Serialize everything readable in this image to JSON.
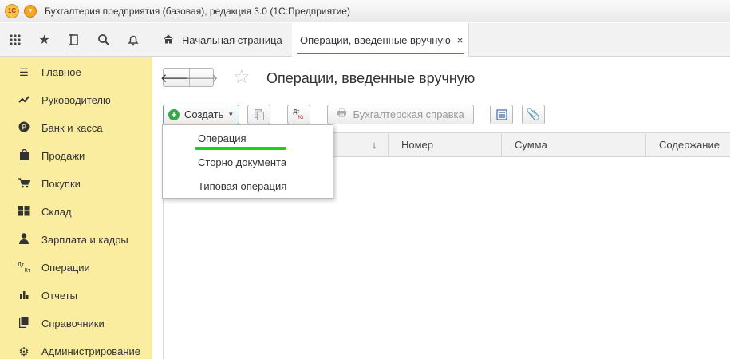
{
  "window": {
    "title": "Бухгалтерия предприятия (базовая), редакция 3.0  (1С:Предприятие)",
    "logo_text": "1С"
  },
  "tabs": {
    "home": "Начальная страница",
    "active": "Операции, введенные вручную",
    "close": "×"
  },
  "sidebar": {
    "items": [
      {
        "label": "Главное",
        "icon": "menu-lines-icon"
      },
      {
        "label": "Руководителю",
        "icon": "trend-icon"
      },
      {
        "label": "Банк и касса",
        "icon": "ruble-icon"
      },
      {
        "label": "Продажи",
        "icon": "shopping-bag-icon"
      },
      {
        "label": "Покупки",
        "icon": "cart-icon"
      },
      {
        "label": "Склад",
        "icon": "warehouse-icon"
      },
      {
        "label": "Зарплата и кадры",
        "icon": "person-icon"
      },
      {
        "label": "Операции",
        "icon": "dt-kt-icon"
      },
      {
        "label": "Отчеты",
        "icon": "bar-chart-icon"
      },
      {
        "label": "Справочники",
        "icon": "book-icon"
      },
      {
        "label": "Администрирование",
        "icon": "gear-icon"
      }
    ]
  },
  "main": {
    "title": "Операции, введенные вручную",
    "create_label": "Создать",
    "dt_label": "Дт",
    "kt_label": "Кт",
    "report_label": "Бухгалтерская справка",
    "columns": {
      "sort": "↓",
      "number": "Номер",
      "sum": "Сумма",
      "content": "Содержание"
    }
  },
  "dropdown": {
    "items": [
      "Операция",
      "Сторно документа",
      "Типовая операция"
    ]
  },
  "colors": {
    "sidebar_bg": "#fbeda0",
    "accent_green": "#2e9d4c",
    "highlight": "#1ad40f"
  }
}
